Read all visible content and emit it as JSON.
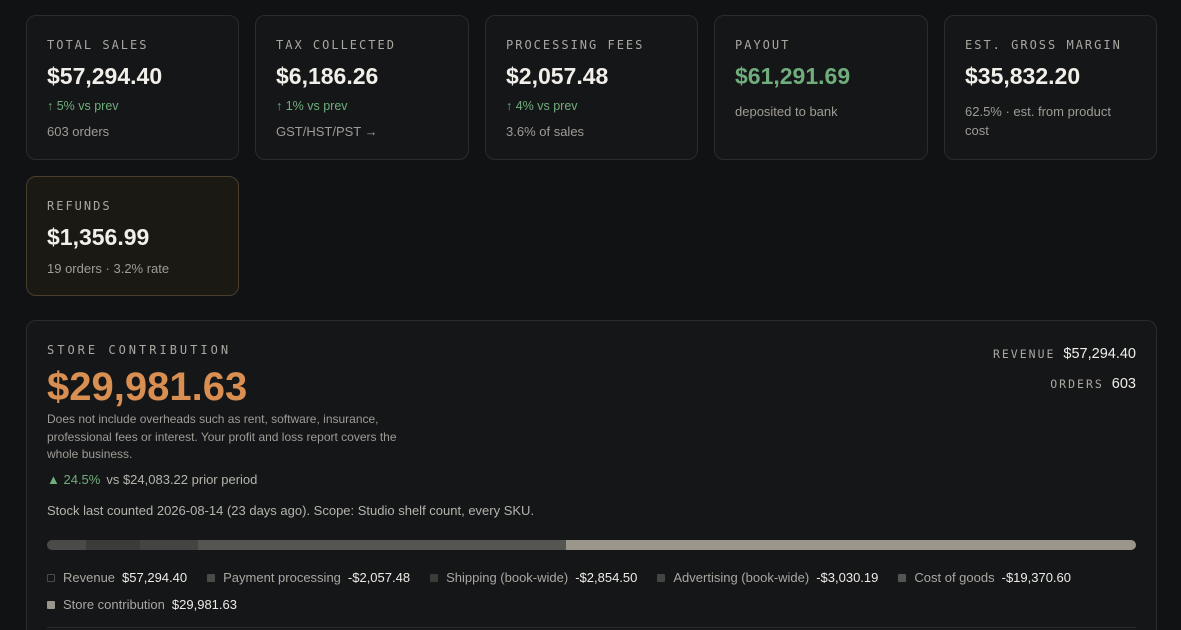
{
  "cards": [
    {
      "label": "TOTAL SALES",
      "value": "$57,294.40",
      "delta": "↑ 5% vs prev",
      "sub": "603 orders"
    },
    {
      "label": "TAX COLLECTED",
      "value": "$6,186.26",
      "delta": "↑ 1% vs prev",
      "sub": "GST/HST/PST →"
    },
    {
      "label": "PROCESSING FEES",
      "value": "$2,057.48",
      "delta": "↑ 4% vs prev",
      "sub": "3.6% of sales"
    },
    {
      "label": "PAYOUT",
      "value": "$61,291.69",
      "sub": "deposited to bank"
    },
    {
      "label": "EST. GROSS MARGIN",
      "value": "$35,832.20",
      "sub": "62.5% · est. from product cost"
    },
    {
      "label": "REFUNDS",
      "value": "$1,356.99",
      "sub": "19 orders · 3.2% rate"
    }
  ],
  "contribution": {
    "label": "STORE CONTRIBUTION",
    "value": "$29,981.63",
    "note": "Does not include overheads such as rent, software, insurance, professional fees or interest. Your profit and loss report covers the whole business.",
    "change_pct": "▲ 24.5%",
    "change_text": "vs $24,083.22 prior period",
    "stock": "Stock last counted 2026-08-14 (23 days ago). Scope: Studio shelf count, every SKU.",
    "revenue_label": "REVENUE",
    "revenue_value": "$57,294.40",
    "orders_label": "ORDERS",
    "orders_value": "603",
    "colors": {
      "payment": "#4a4a48",
      "shipping": "#3b3b3a",
      "advertising": "#444443",
      "cogs": "#555552",
      "contribution": "#9b968b"
    },
    "breakdown": {
      "revenue": 57294.4,
      "payment": 2057.48,
      "shipping": 2854.5,
      "advertising": 3030.19,
      "cogs": 19370.6,
      "contribution": 29981.63
    },
    "legend": [
      {
        "name": "Revenue",
        "value": "$57,294.40",
        "icon": "outline-square"
      },
      {
        "name": "Payment processing",
        "value": "-$2,057.48"
      },
      {
        "name": "Shipping (book-wide)",
        "value": "-$2,854.50"
      },
      {
        "name": "Advertising (book-wide)",
        "value": "-$3,030.19"
      },
      {
        "name": "Cost of goods",
        "value": "-$19,370.60"
      },
      {
        "name": "Store contribution",
        "value": "$29,981.63"
      }
    ]
  }
}
